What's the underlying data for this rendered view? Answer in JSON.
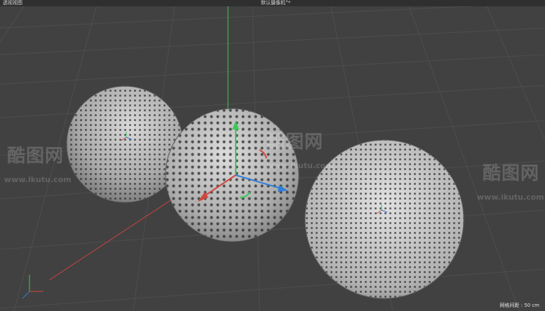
{
  "viewport": {
    "name": "透视视图",
    "camera": "默认摄像机°*",
    "grid_spacing_label": "网格间距 : 50 cm"
  },
  "watermark": {
    "brand_left": "酷图网",
    "url_left": "www.ikutu.com",
    "brand_right": "酷图网",
    "url_right": "www.ikutu.com",
    "brand_center": "酷图网",
    "url_center": "www.ikutu.com"
  },
  "colors": {
    "background": "#414141",
    "grid": "#4d4d4d",
    "x_axis": "#d0463f",
    "y_axis": "#3ec85a",
    "z_axis": "#2f7fd8",
    "sphere": "#b8b8b8"
  }
}
